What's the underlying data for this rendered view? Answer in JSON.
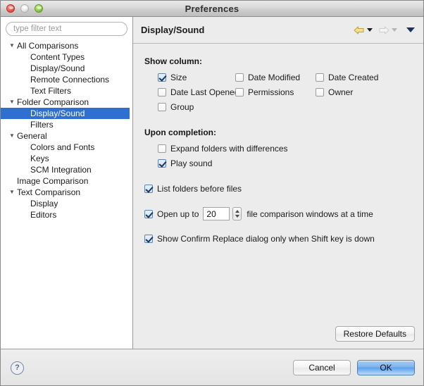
{
  "window": {
    "title": "Preferences",
    "traffic_lights": [
      "close-red",
      "minimize-gray",
      "zoom-green"
    ]
  },
  "sidebar": {
    "filter": {
      "value": "",
      "placeholder": "type filter text"
    },
    "items": [
      {
        "label": "All Comparisons",
        "level": 0,
        "twisty": "▼",
        "selected": false
      },
      {
        "label": "Content Types",
        "level": 1,
        "twisty": "",
        "selected": false
      },
      {
        "label": "Display/Sound",
        "level": 1,
        "twisty": "",
        "selected": false
      },
      {
        "label": "Remote Connections",
        "level": 1,
        "twisty": "",
        "selected": false
      },
      {
        "label": "Text Filters",
        "level": 1,
        "twisty": "",
        "selected": false
      },
      {
        "label": "Folder Comparison",
        "level": 0,
        "twisty": "▼",
        "selected": false
      },
      {
        "label": "Display/Sound",
        "level": 1,
        "twisty": "",
        "selected": true
      },
      {
        "label": "Filters",
        "level": 1,
        "twisty": "",
        "selected": false
      },
      {
        "label": "General",
        "level": 0,
        "twisty": "▼",
        "selected": false
      },
      {
        "label": "Colors and Fonts",
        "level": 1,
        "twisty": "",
        "selected": false
      },
      {
        "label": "Keys",
        "level": 1,
        "twisty": "",
        "selected": false
      },
      {
        "label": "SCM Integration",
        "level": 1,
        "twisty": "",
        "selected": false
      },
      {
        "label": "Image Comparison",
        "level": 0,
        "twisty": "",
        "selected": false
      },
      {
        "label": "Text Comparison",
        "level": 0,
        "twisty": "▼",
        "selected": false
      },
      {
        "label": "Display",
        "level": 1,
        "twisty": "",
        "selected": false
      },
      {
        "label": "Editors",
        "level": 1,
        "twisty": "",
        "selected": false
      }
    ],
    "selection_color": "#2f6fd0"
  },
  "panel": {
    "title": "Display/Sound",
    "toolbar": {
      "back_icon": "back-arrow-icon",
      "back_enabled": true,
      "forward_icon": "forward-arrow-icon",
      "forward_enabled": false,
      "menu_icon": "chevron-down-icon"
    },
    "show_column": {
      "heading": "Show column:",
      "options": [
        {
          "label": "Size",
          "checked": true
        },
        {
          "label": "Date Modified",
          "checked": false
        },
        {
          "label": "Date Created",
          "checked": false
        },
        {
          "label": "Date Last Opened",
          "checked": false
        },
        {
          "label": "Permissions",
          "checked": false
        },
        {
          "label": "Owner",
          "checked": false
        },
        {
          "label": "Group",
          "checked": false
        }
      ]
    },
    "upon_completion": {
      "heading": "Upon completion:",
      "options": [
        {
          "label": "Expand folders with differences",
          "checked": false
        },
        {
          "label": "Play sound",
          "checked": true
        }
      ]
    },
    "list_folders": {
      "label": "List folders before files",
      "checked": true
    },
    "open_up_to": {
      "checked": true,
      "prefix": "Open up to",
      "value": "20",
      "suffix": "file comparison windows at a time",
      "stepper_up": "stepper-up-icon",
      "stepper_down": "stepper-down-icon"
    },
    "confirm_replace": {
      "label": "Show Confirm Replace dialog only when Shift key is down",
      "checked": true
    },
    "restore_defaults_label": "Restore Defaults"
  },
  "footer": {
    "help_icon": "help-icon",
    "help_glyph": "?",
    "cancel_label": "Cancel",
    "ok_label": "OK",
    "ok_accent": "#5ba0ea"
  }
}
